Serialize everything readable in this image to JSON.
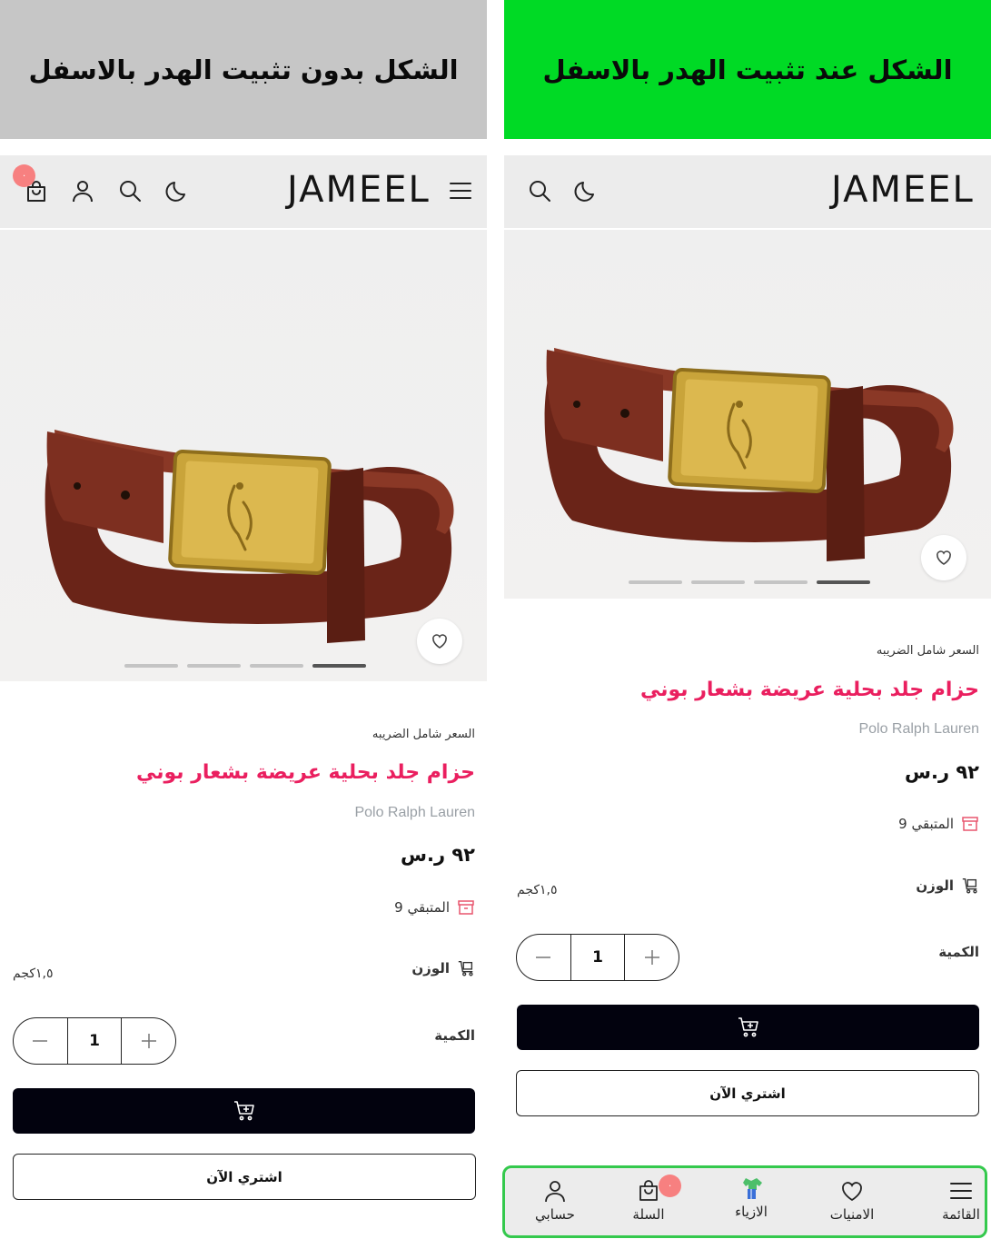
{
  "banners": {
    "left": "الشكل بدون تثبيت الهدر بالاسفل",
    "right": "الشكل عند تثبيت الهدر بالاسفل"
  },
  "header": {
    "logo": "JAMEEL",
    "cart_badge": "٠"
  },
  "product": {
    "tax_note": "السعر شامل الضريبه",
    "title": "حزام جلد بحلية عريضة بشعار بوني",
    "brand": "Polo Ralph Lauren",
    "price": "٩٢ ر.س",
    "stock_label": "المتبقي 9",
    "weight_label": "الوزن",
    "weight_value": "١,٥كجم",
    "quantity_label": "الكمية",
    "quantity_value": "1",
    "buy_now": "اشتري الآن",
    "gallery_slides": 4,
    "gallery_active": 4
  },
  "bottom_nav": {
    "items": [
      {
        "label": "القائمة",
        "icon": "menu-icon"
      },
      {
        "label": "الامنيات",
        "icon": "heart-icon"
      },
      {
        "label": "الازياء",
        "icon": "clothes-icon"
      },
      {
        "label": "السلة",
        "icon": "cart-bag-icon"
      },
      {
        "label": "حسابي",
        "icon": "user-icon"
      }
    ],
    "cart_badge": "٠"
  },
  "colors": {
    "left_banner": "#c6c6c6",
    "right_banner": "#00da25",
    "title_accent": "#ea1f5f",
    "badge": "#f78080",
    "cart_button": "#02020e",
    "nav_border": "#34c94d"
  }
}
